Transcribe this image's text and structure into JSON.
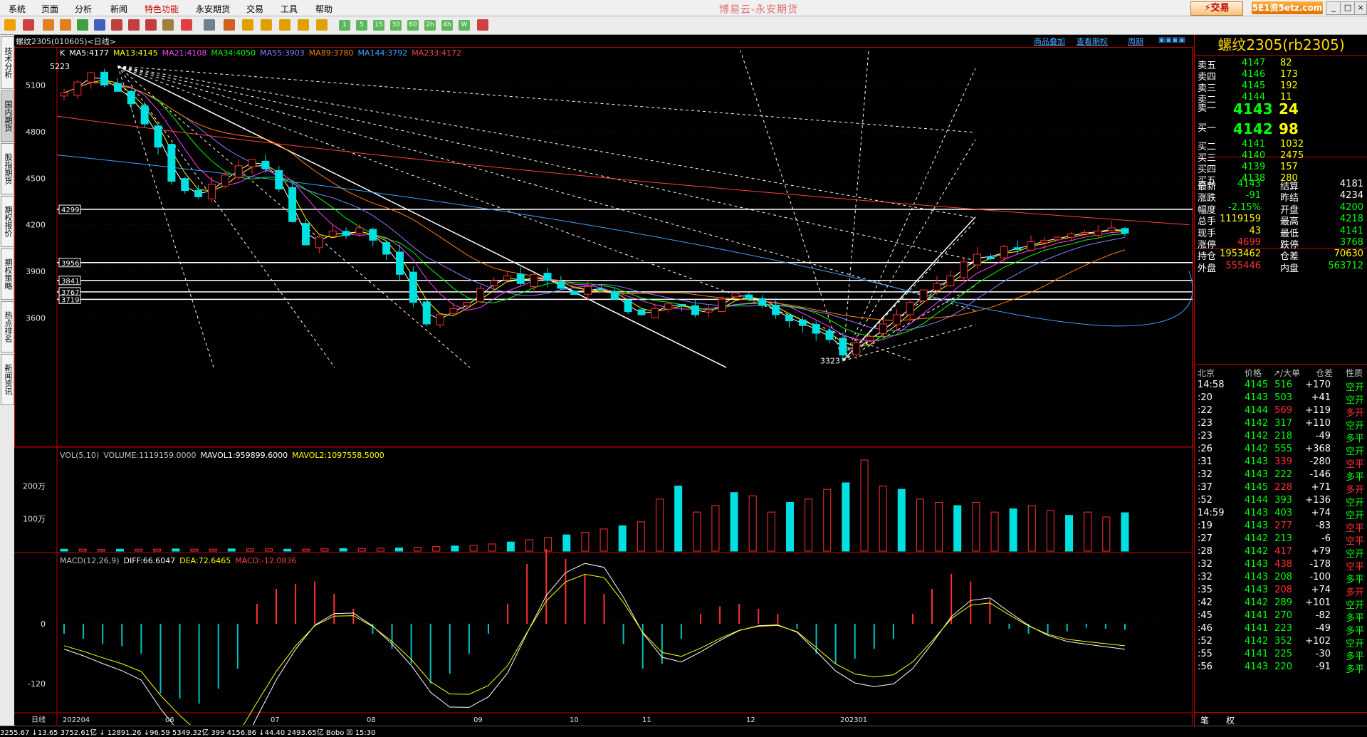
{
  "menu": {
    "items": [
      "系统",
      "页面",
      "分析",
      "新闻",
      "特色功能",
      "永安期货",
      "交易",
      "工具",
      "帮助"
    ],
    "window_title": "博易云-永安期货",
    "trade_button": "⚡交易",
    "brand": "5E1资5etz.com",
    "win_buttons": [
      "_",
      "□",
      "×"
    ]
  },
  "toolbar": {
    "number_buttons": [
      "1",
      "5",
      "15",
      "30",
      "60",
      "2h",
      "4h",
      "W"
    ]
  },
  "left_tabs": [
    "技术分析",
    "国内期货",
    "股指期货",
    "期权报价",
    "期权策略",
    "热点排名",
    "新闻资讯"
  ],
  "chart_header": {
    "title": "螺纹2305(010605)<日线>",
    "links": [
      "商品叠加",
      "查看期权",
      "周期"
    ]
  },
  "ma_legend": [
    {
      "text": "K",
      "color": "#ffffff"
    },
    {
      "text": "MA5:4177",
      "color": "#ffffff"
    },
    {
      "text": "MA13:4145",
      "color": "#ffff00"
    },
    {
      "text": "MA21:4108",
      "color": "#ff40ff"
    },
    {
      "text": "MA34:4050",
      "color": "#00ff00"
    },
    {
      "text": "MA55:3903",
      "color": "#8080ff"
    },
    {
      "text": "MA89:3780",
      "color": "#ff8000"
    },
    {
      "text": "MA144:3792",
      "color": "#40a0ff"
    },
    {
      "text": "MA233:4172",
      "color": "#ff4040"
    }
  ],
  "vol_legend": [
    {
      "text": "VOL(5,10)",
      "color": "#c0c0c0"
    },
    {
      "text": "VOLUME:1119159.0000",
      "color": "#c0c0c0"
    },
    {
      "text": "MAVOL1:959899.6000",
      "color": "#ffffff"
    },
    {
      "text": "MAVOL2:1097558.5000",
      "color": "#ffff00"
    }
  ],
  "macd_legend": [
    {
      "text": "MACD(12,26,9)",
      "color": "#c0c0c0"
    },
    {
      "text": "DIFF:66.6047",
      "color": "#ffffff"
    },
    {
      "text": "DEA:72.6465",
      "color": "#ffff00"
    },
    {
      "text": "MACD:-12.0836",
      "color": "#ff4040"
    }
  ],
  "chart_data": {
    "type": "candlestick",
    "price_axis_ticks": [
      "5100",
      "4800",
      "4500",
      "4200",
      "3900",
      "3600"
    ],
    "vol_axis_ticks": [
      "200万",
      "100万"
    ],
    "macd_axis_ticks": [
      "0",
      "-120"
    ],
    "date_ticks": [
      "日线",
      "202204",
      "06",
      "07",
      "08",
      "09",
      "10",
      "11",
      "12",
      "202301"
    ],
    "price_range": [
      3280,
      5300
    ],
    "high_label": "5223",
    "low_label": "3323",
    "horizontal_levels": [
      "4299",
      "3956",
      "3841",
      "3767",
      "3719"
    ],
    "close_path": [
      5050,
      5120,
      5180,
      5100,
      5060,
      4980,
      4850,
      4700,
      4480,
      4420,
      4380,
      4460,
      4520,
      4580,
      4620,
      4560,
      4430,
      4220,
      4070,
      4120,
      4160,
      4130,
      4180,
      4100,
      4010,
      3880,
      3700,
      3560,
      3620,
      3660,
      3700,
      3790,
      3840,
      3870,
      3820,
      3880,
      3840,
      3790,
      3750,
      3800,
      3780,
      3720,
      3640,
      3620,
      3660,
      3690,
      3680,
      3620,
      3650,
      3720,
      3760,
      3720,
      3680,
      3620,
      3580,
      3550,
      3500,
      3460,
      3360,
      3440,
      3480,
      3560,
      3620,
      3700,
      3780,
      3820,
      3870,
      3960,
      4010,
      3980,
      4060,
      4040,
      4090,
      4100,
      4120,
      4140,
      4150,
      4160,
      4180,
      4145
    ],
    "volume_path": [
      6,
      6,
      5,
      6,
      6,
      6,
      7,
      6,
      6,
      7,
      7,
      7,
      6,
      6,
      7,
      8,
      8,
      9,
      10,
      12,
      14,
      16,
      18,
      22,
      28,
      35,
      42,
      50,
      58,
      68,
      78,
      90,
      160,
      200,
      120,
      140,
      180,
      170,
      120,
      150,
      160,
      190,
      210,
      280,
      200,
      190,
      160,
      150,
      140,
      150,
      120,
      130,
      140,
      125,
      110,
      120,
      105,
      118
    ],
    "macd_hist": [
      -20,
      -30,
      -40,
      -45,
      -60,
      -140,
      -150,
      -160,
      -130,
      -90,
      40,
      70,
      80,
      85,
      60,
      30,
      -20,
      -50,
      -80,
      -120,
      -100,
      -60,
      -20,
      40,
      120,
      150,
      130,
      100,
      60,
      -40,
      -90,
      -80,
      -30,
      20,
      35,
      40,
      30,
      20,
      -10,
      -60,
      -80,
      -70,
      -50,
      -30,
      20,
      70,
      100,
      85,
      50,
      -10,
      -20,
      -20,
      -15,
      -8,
      -10,
      -12
    ]
  },
  "quote": {
    "title": "螺纹2305(rb2305)",
    "asks": [
      {
        "label": "卖五",
        "price": "4147",
        "vol": "82"
      },
      {
        "label": "卖四",
        "price": "4146",
        "vol": "173"
      },
      {
        "label": "卖三",
        "price": "4145",
        "vol": "192"
      },
      {
        "label": "卖二",
        "price": "4144",
        "vol": "11"
      }
    ],
    "ask1": {
      "label": "卖一",
      "price": "4143",
      "vol": "24"
    },
    "bid1": {
      "label": "买一",
      "price": "4142",
      "vol": "98"
    },
    "bids": [
      {
        "label": "买二",
        "price": "4141",
        "vol": "1032"
      },
      {
        "label": "买三",
        "price": "4140",
        "vol": "2475"
      },
      {
        "label": "买四",
        "price": "4139",
        "vol": "157"
      },
      {
        "label": "买五",
        "price": "4138",
        "vol": "280"
      }
    ],
    "stats": [
      {
        "l1": "最新",
        "v1": "4143",
        "c1": "#00ff00",
        "l2": "结算",
        "v2": "4181",
        "c2": "#ffffff"
      },
      {
        "l1": "涨跌",
        "v1": "-91",
        "c1": "#00ff00",
        "l2": "昨结",
        "v2": "4234",
        "c2": "#ffffff"
      },
      {
        "l1": "幅度",
        "v1": "-2.15%",
        "c1": "#00ff00",
        "l2": "开盘",
        "v2": "4200",
        "c2": "#00ff00"
      },
      {
        "l1": "总手",
        "v1": "1119159",
        "c1": "#ffff00",
        "l2": "最高",
        "v2": "4218",
        "c2": "#00ff00"
      },
      {
        "l1": "现手",
        "v1": "43",
        "c1": "#ffff00",
        "l2": "最低",
        "v2": "4141",
        "c2": "#00ff00"
      },
      {
        "l1": "涨停",
        "v1": "4699",
        "c1": "#ff3030",
        "l2": "跌停",
        "v2": "3768",
        "c2": "#00ff00"
      },
      {
        "l1": "持仓",
        "v1": "1953462",
        "c1": "#ffff00",
        "l2": "仓差",
        "v2": "70630",
        "c2": "#ffff00"
      },
      {
        "l1": "外盘",
        "v1": "555446",
        "c1": "#ff3030",
        "l2": "内盘",
        "v2": "563712",
        "c2": "#00ff00"
      }
    ],
    "tick_header": [
      "北京",
      "价格",
      "↗/大单",
      "仓差",
      "性质"
    ],
    "ticks": [
      {
        "t": "14:58",
        "p": "4145",
        "v": "516",
        "d": "+170",
        "n": "空开",
        "vc": "#00ff00",
        "nc": "#00ff00"
      },
      {
        "t": ":20",
        "p": "4143",
        "v": "503",
        "d": "+41",
        "n": "空开",
        "vc": "#00ff00",
        "nc": "#00ff00"
      },
      {
        "t": ":22",
        "p": "4144",
        "v": "569",
        "d": "+119",
        "n": "多开",
        "vc": "#ff3030",
        "nc": "#ff3030"
      },
      {
        "t": ":23",
        "p": "4142",
        "v": "317",
        "d": "+110",
        "n": "空开",
        "vc": "#00ff00",
        "nc": "#00ff00"
      },
      {
        "t": ":23",
        "p": "4142",
        "v": "218",
        "d": "-49",
        "n": "多平",
        "vc": "#00ff00",
        "nc": "#00ff00"
      },
      {
        "t": ":26",
        "p": "4142",
        "v": "555",
        "d": "+368",
        "n": "空开",
        "vc": "#00ff00",
        "nc": "#00ff00"
      },
      {
        "t": ":31",
        "p": "4143",
        "v": "339",
        "d": "-280",
        "n": "空平",
        "vc": "#ff3030",
        "nc": "#ff3030"
      },
      {
        "t": ":32",
        "p": "4143",
        "v": "222",
        "d": "-146",
        "n": "多平",
        "vc": "#00ff00",
        "nc": "#00ff00"
      },
      {
        "t": ":37",
        "p": "4145",
        "v": "228",
        "d": "+71",
        "n": "多开",
        "vc": "#ff3030",
        "nc": "#ff3030"
      },
      {
        "t": ":52",
        "p": "4144",
        "v": "393",
        "d": "+136",
        "n": "空开",
        "vc": "#00ff00",
        "nc": "#00ff00"
      },
      {
        "t": "14:59",
        "p": "4143",
        "v": "403",
        "d": "+74",
        "n": "空开",
        "vc": "#00ff00",
        "nc": "#00ff00"
      },
      {
        "t": ":19",
        "p": "4143",
        "v": "277",
        "d": "-83",
        "n": "空平",
        "vc": "#ff3030",
        "nc": "#ff3030"
      },
      {
        "t": ":27",
        "p": "4142",
        "v": "213",
        "d": "-6",
        "n": "空平",
        "vc": "#00ff00",
        "nc": "#ff3030"
      },
      {
        "t": ":28",
        "p": "4142",
        "v": "417",
        "d": "+79",
        "n": "空开",
        "vc": "#ff3030",
        "nc": "#00ff00"
      },
      {
        "t": ":32",
        "p": "4143",
        "v": "438",
        "d": "-178",
        "n": "空平",
        "vc": "#ff3030",
        "nc": "#ff3030"
      },
      {
        "t": ":32",
        "p": "4143",
        "v": "208",
        "d": "-100",
        "n": "多平",
        "vc": "#00ff00",
        "nc": "#00ff00"
      },
      {
        "t": ":35",
        "p": "4143",
        "v": "208",
        "d": "+74",
        "n": "多开",
        "vc": "#ff3030",
        "nc": "#ff3030"
      },
      {
        "t": ":42",
        "p": "4142",
        "v": "289",
        "d": "+101",
        "n": "空开",
        "vc": "#00ff00",
        "nc": "#00ff00"
      },
      {
        "t": ":45",
        "p": "4141",
        "v": "270",
        "d": "-82",
        "n": "多平",
        "vc": "#00ff00",
        "nc": "#00ff00"
      },
      {
        "t": ":46",
        "p": "4141",
        "v": "223",
        "d": "-49",
        "n": "多平",
        "vc": "#00ff00",
        "nc": "#00ff00"
      },
      {
        "t": ":52",
        "p": "4142",
        "v": "352",
        "d": "+102",
        "n": "空开",
        "vc": "#00ff00",
        "nc": "#00ff00"
      },
      {
        "t": ":55",
        "p": "4141",
        "v": "225",
        "d": "-30",
        "n": "多平",
        "vc": "#00ff00",
        "nc": "#00ff00"
      },
      {
        "t": ":56",
        "p": "4143",
        "v": "220",
        "d": "-91",
        "n": "多平",
        "vc": "#00ff00",
        "nc": "#00ff00"
      }
    ],
    "bottom_tabs": [
      "笔",
      "权"
    ]
  },
  "status_bar": "3255.67  ↓13.65  3752.61亿    ↓ 12891.26  ↓96.59  5349.32亿    399  4156.86  ↓44.40  2493.65亿                                                   Bobo  ☒  15:30"
}
